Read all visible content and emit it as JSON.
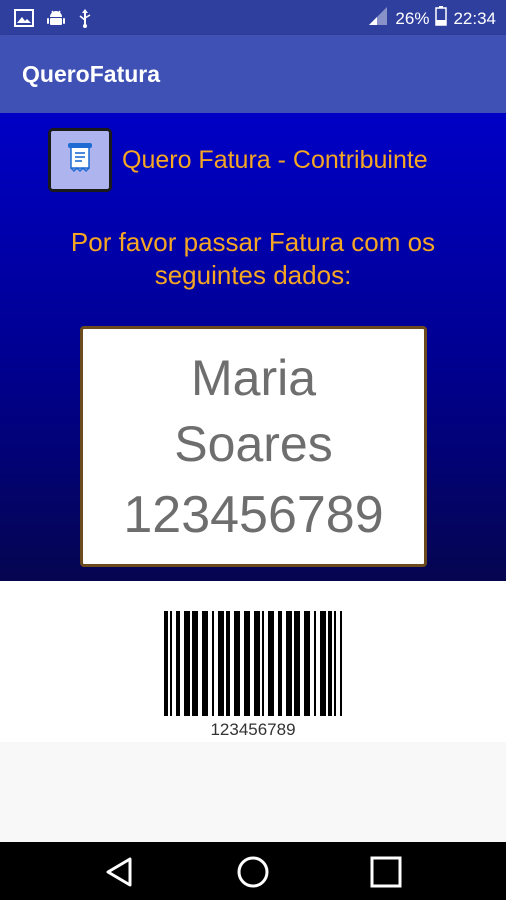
{
  "status_bar": {
    "battery_percent": "26%",
    "time": "22:34",
    "icons_left": [
      "image-icon",
      "android-icon",
      "usb-icon"
    ],
    "icons_right": [
      "signal-icon",
      "battery-icon"
    ]
  },
  "app_bar": {
    "title": "QueroFatura"
  },
  "header": {
    "logo_icon": "receipt-icon",
    "title": "Quero Fatura - Contribuinte"
  },
  "instruction": {
    "line1": "Por favor passar Fatura com os",
    "line2": "seguintes dados:"
  },
  "taxpayer": {
    "first_name": "Maria",
    "last_name": "Soares",
    "nif": "123456789"
  },
  "barcode": {
    "value": "123456789",
    "caption": "123456789"
  },
  "nav_bar": {
    "buttons": [
      "back-icon",
      "home-icon",
      "recents-icon"
    ]
  },
  "colors": {
    "status_bar": "#2f3f9e",
    "app_bar": "#3f51b5",
    "gradient_top": "#0000c6",
    "gradient_bottom": "#050550",
    "accent_text": "#f5a623",
    "card_border": "#6b4a1e"
  }
}
